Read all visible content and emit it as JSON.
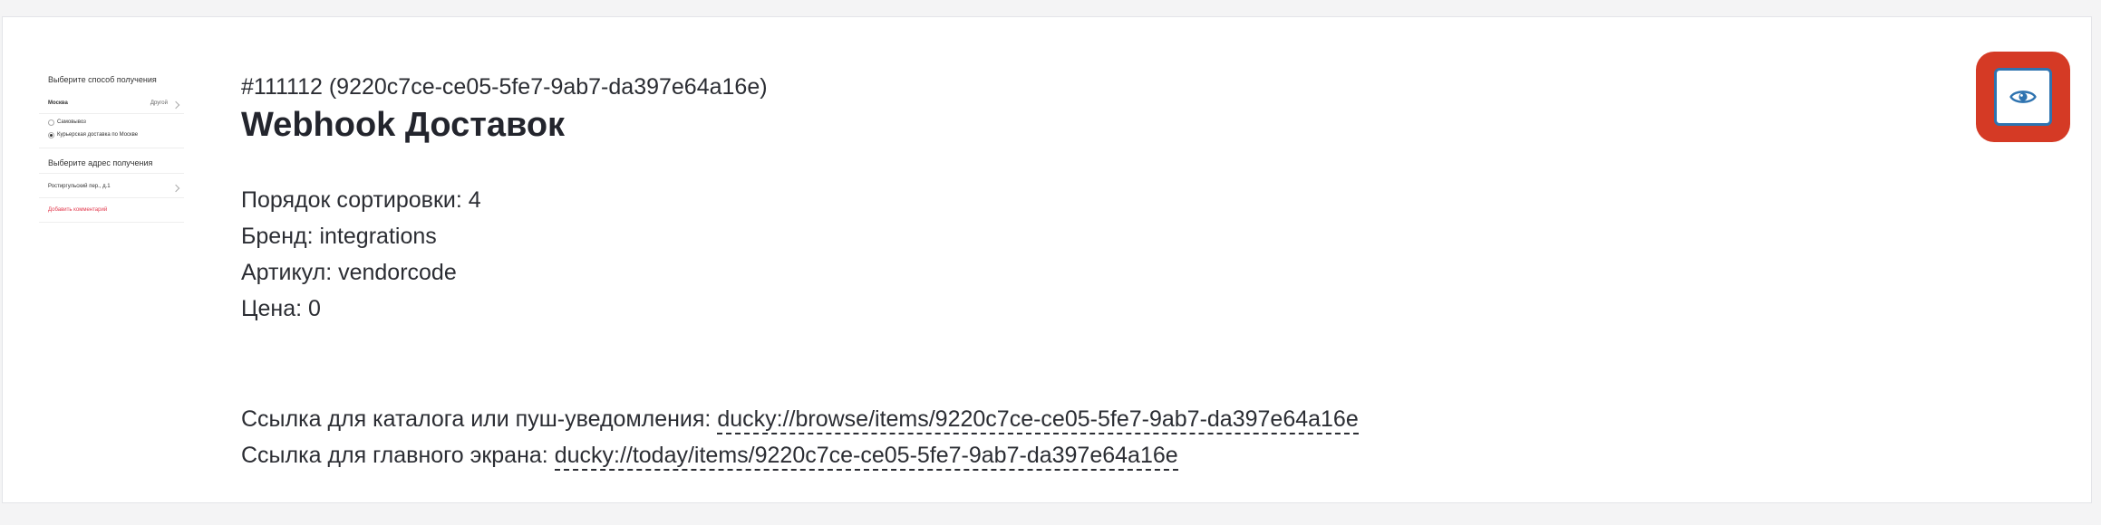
{
  "thumbnail": {
    "heading_method": "Выберите способ получения",
    "city": "Москва",
    "city_action": "Другой",
    "option_pickup": "Самовывоз",
    "option_courier": "Курьерская доставка по Москве",
    "heading_address": "Выберите адрес получения",
    "address": "Ростиргульский пер., д.1",
    "add_comment": "Добавить комментарий"
  },
  "item": {
    "id_line": "#111112 (9220c7ce-ce05-5fe7-9ab7-da397e64a16e)",
    "title": "Webhook Доставок",
    "sort_order": "Порядок сортировки: 4",
    "brand": "Бренд: integrations",
    "article": "Артикул: vendorcode",
    "price": "Цена: 0",
    "catalog_link_label": "Ссылка для каталога или пуш-уведомления: ",
    "catalog_link": "ducky://browse/items/9220c7ce-ce05-5fe7-9ab7-da397e64a16e",
    "home_link_label": "Ссылка для главного экрана: ",
    "home_link": "ducky://today/items/9220c7ce-ce05-5fe7-9ab7-da397e64a16e"
  },
  "actions": {
    "view_icon": "eye-icon",
    "highlight_color": "#d53a25",
    "button_border_color": "#2e73b0"
  }
}
